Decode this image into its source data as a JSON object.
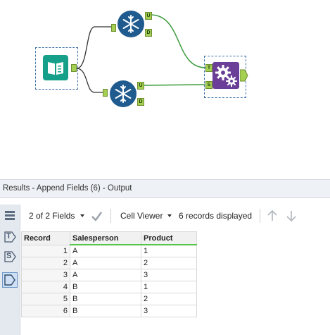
{
  "canvas": {
    "tools": [
      {
        "name": "input-data-tool"
      },
      {
        "name": "generate-rows-tool-top"
      },
      {
        "name": "generate-rows-tool-bottom"
      },
      {
        "name": "append-fields-tool"
      }
    ],
    "anchors": {
      "U": "U",
      "D": "D",
      "T": "T",
      "S": "S"
    }
  },
  "results": {
    "title": "Results - Append Fields (6) - Output",
    "fields_label": "2 of 2 Fields",
    "viewer_label": "Cell Viewer",
    "records_label": "6 records displayed",
    "columns": [
      "Record",
      "Salesperson",
      "Product"
    ],
    "rows": [
      {
        "record": "1",
        "salesperson": "A",
        "product": "1"
      },
      {
        "record": "2",
        "salesperson": "A",
        "product": "2"
      },
      {
        "record": "3",
        "salesperson": "A",
        "product": "3"
      },
      {
        "record": "4",
        "salesperson": "B",
        "product": "1"
      },
      {
        "record": "5",
        "salesperson": "B",
        "product": "2"
      },
      {
        "record": "6",
        "salesperson": "B",
        "product": "3"
      }
    ],
    "sidebar_labels": {
      "t": "T",
      "s": "S"
    }
  }
}
